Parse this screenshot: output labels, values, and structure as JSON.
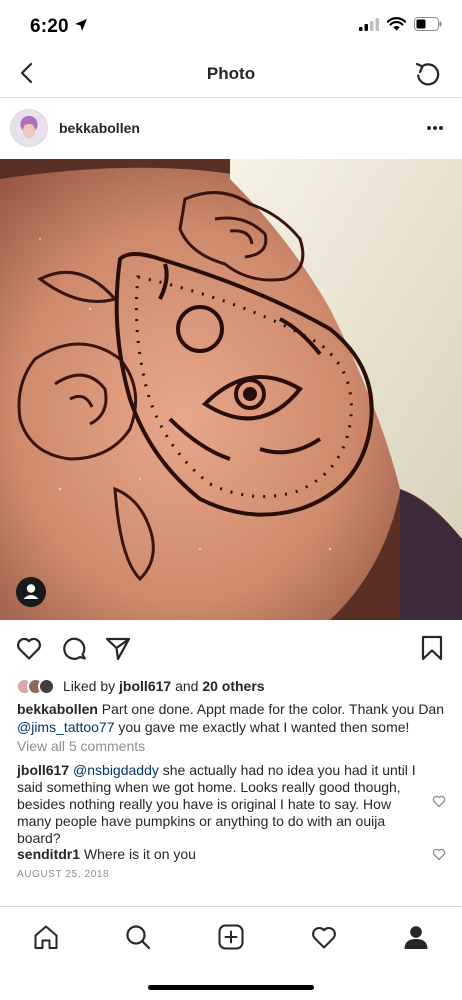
{
  "status": {
    "time": "6:20",
    "icons": [
      "location-arrow-icon",
      "cellular-signal-icon",
      "wifi-icon",
      "battery-icon"
    ]
  },
  "nav": {
    "title": "Photo",
    "back_icon": "chevron-left-icon",
    "refresh_icon": "refresh-icon"
  },
  "post": {
    "username": "bekkabollen",
    "more_icon": "more-horizontal-icon",
    "photo_icon": "user-tag-icon",
    "likes": {
      "prefix": "Liked by ",
      "user": "jboll617",
      "middle": " and ",
      "others": "20 others"
    },
    "caption": {
      "username": "bekkabollen",
      "text_before": " Part one done. Appt made for the color. Thank you Dan ",
      "mention": "@jims_tattoo77",
      "text_after": " you gave me exactly what I wanted then some!"
    },
    "view_all_comments": "View all 5 comments",
    "comments": [
      {
        "username": "jboll617",
        "mention": "@nsbigdaddy",
        "text": " she actually had no idea you had it until I said something when we got home. Looks really good though, besides nothing really you have is original I hate to say. How many people have pumpkins or anything to do with an ouija board?"
      },
      {
        "username": "senditdr1",
        "mention": "",
        "text": " Where is it on you"
      }
    ],
    "date": "AUGUST 25, 2018"
  },
  "actions": [
    "heart-icon",
    "comment-icon",
    "share-icon",
    "bookmark-icon"
  ],
  "tabs": [
    "home-icon",
    "search-icon",
    "add-post-icon",
    "activity-heart-icon",
    "profile-icon"
  ],
  "colors": {
    "text": "#262626",
    "secondary": "#8e8e8e",
    "mention": "#003569",
    "divider": "#dbdbdb"
  }
}
